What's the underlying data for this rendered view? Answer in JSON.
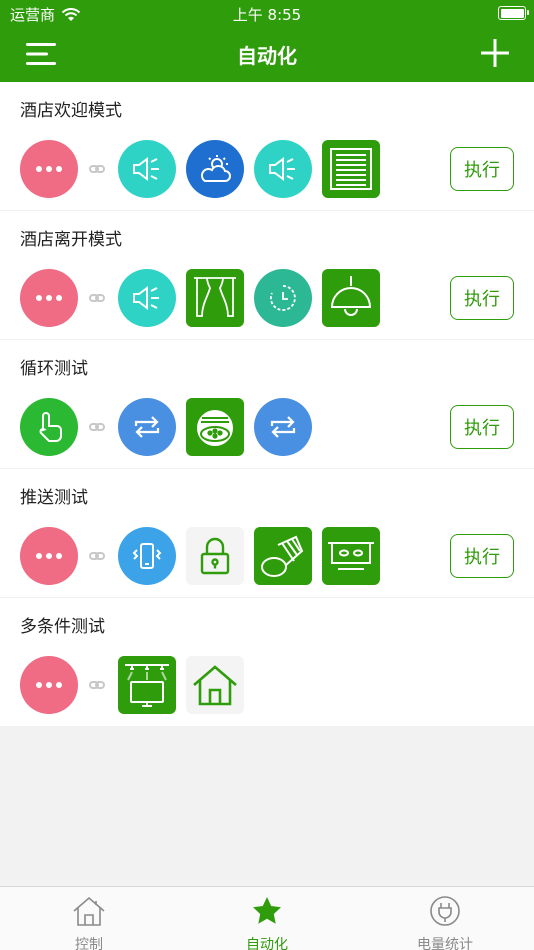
{
  "status_bar": {
    "carrier": "运营商",
    "time": "上午 8:55"
  },
  "nav": {
    "title": "自动化"
  },
  "scenes": [
    {
      "name": "酒店欢迎模式",
      "exec_label": "执行",
      "trigger": {
        "icon": "more-icon",
        "color": "#f06b84"
      },
      "actions": [
        {
          "icon": "speaker-icon",
          "color": "#2fd3c6",
          "shape": "circle"
        },
        {
          "icon": "weather-icon",
          "color": "#1e6fd0",
          "shape": "circle"
        },
        {
          "icon": "speaker-icon",
          "color": "#2fd3c6",
          "shape": "circle"
        },
        {
          "icon": "blinds-icon",
          "color": "#2f9c0b",
          "shape": "square"
        }
      ]
    },
    {
      "name": "酒店离开模式",
      "exec_label": "执行",
      "trigger": {
        "icon": "more-icon",
        "color": "#f06b84"
      },
      "actions": [
        {
          "icon": "speaker-icon",
          "color": "#2fd3c6",
          "shape": "circle"
        },
        {
          "icon": "curtain-icon",
          "color": "#2f9c0b",
          "shape": "square"
        },
        {
          "icon": "timer-icon",
          "color": "#2db895",
          "shape": "circle"
        },
        {
          "icon": "pendant-lamp-icon",
          "color": "#2f9c0b",
          "shape": "square"
        }
      ]
    },
    {
      "name": "循环测试",
      "exec_label": "执行",
      "trigger": {
        "icon": "touch-icon",
        "color": "#2bb934"
      },
      "actions": [
        {
          "icon": "loop-icon",
          "color": "#4a90e2",
          "shape": "circle"
        },
        {
          "icon": "ceiling-light-icon",
          "color": "#2f9c0b",
          "shape": "square"
        },
        {
          "icon": "loop-icon",
          "color": "#4a90e2",
          "shape": "circle"
        }
      ]
    },
    {
      "name": "推送测试",
      "exec_label": "执行",
      "trigger": {
        "icon": "more-icon",
        "color": "#f06b84"
      },
      "actions": [
        {
          "icon": "phone-vibrate-icon",
          "color": "#3da3e8",
          "shape": "circle"
        },
        {
          "icon": "lock-icon",
          "color": "#f4f4f4",
          "shape": "square"
        },
        {
          "icon": "spotlight-icon",
          "color": "#2f9c0b",
          "shape": "square"
        },
        {
          "icon": "range-hood-icon",
          "color": "#2f9c0b",
          "shape": "square"
        }
      ]
    },
    {
      "name": "多条件测试",
      "exec_label": "",
      "trigger": {
        "icon": "more-icon",
        "color": "#f06b84"
      },
      "actions": [
        {
          "icon": "tv-light-icon",
          "color": "#2f9c0b",
          "shape": "square"
        },
        {
          "icon": "home-icon",
          "color": "#f4f4f4",
          "shape": "square"
        }
      ]
    }
  ],
  "tabs": [
    {
      "label": "控制",
      "icon": "house-icon",
      "active": false
    },
    {
      "label": "自动化",
      "icon": "star-icon",
      "active": true
    },
    {
      "label": "电量统计",
      "icon": "plug-icon",
      "active": false
    }
  ],
  "colors": {
    "brand": "#2f9c0b",
    "tab_inactive": "#8a8a8a"
  }
}
